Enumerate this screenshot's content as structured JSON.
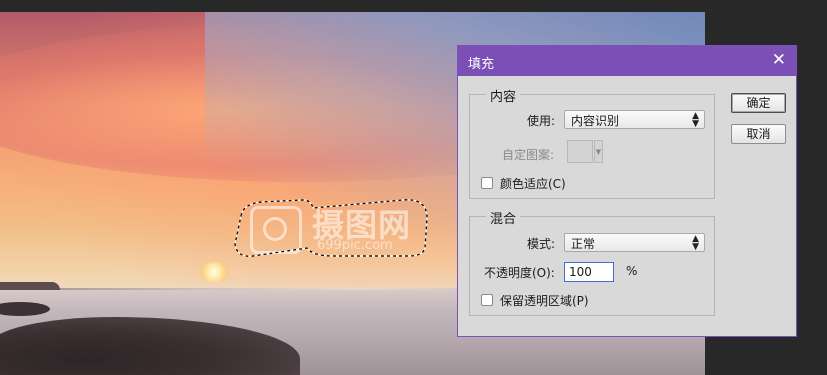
{
  "canvas": {
    "watermark_text": "摄图网",
    "watermark_sub": "699pic.com"
  },
  "dialog": {
    "title": "填充",
    "close_glyph": "✕",
    "content_group": {
      "legend": "内容",
      "use_label": "使用:",
      "use_value": "内容识别",
      "pattern_label": "自定图案:",
      "color_adapt_label": "颜色适应(C)",
      "color_adapt_checked": false
    },
    "blend_group": {
      "legend": "混合",
      "mode_label": "模式:",
      "mode_value": "正常",
      "opacity_label": "不透明度(O):",
      "opacity_value": "100",
      "opacity_unit": "%",
      "preserve_label": "保留透明区域(P)",
      "preserve_checked": false
    },
    "buttons": {
      "ok": "确定",
      "cancel": "取消"
    }
  },
  "colors": {
    "titlebar": "#7b4fb5",
    "dialog_bg": "#d9d9d9",
    "workspace_bg": "#282828"
  }
}
